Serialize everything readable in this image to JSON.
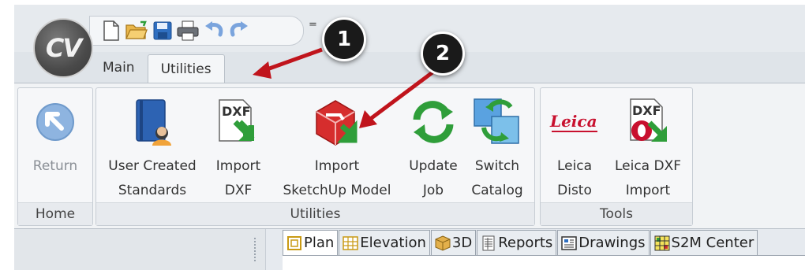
{
  "app": {
    "logo_text": "CV"
  },
  "quick_access": {
    "icons": [
      "new-document-icon",
      "open-folder-icon",
      "save-icon",
      "print-icon",
      "undo-icon",
      "redo-icon"
    ],
    "more_label": "="
  },
  "tabs": [
    {
      "label": "Main"
    },
    {
      "label": "Utilities"
    }
  ],
  "ribbon": {
    "home_group": {
      "label": "Home",
      "buttons": [
        {
          "line1": "Return",
          "line2": ""
        }
      ]
    },
    "utilities_group": {
      "label": "Utilities",
      "buttons": [
        {
          "line1": "User Created",
          "line2": "Standards"
        },
        {
          "line1": "Import",
          "line2": "DXF"
        },
        {
          "line1": "Import",
          "line2": "SketchUp Model"
        },
        {
          "line1": "Update",
          "line2": "Job"
        },
        {
          "line1": "Switch",
          "line2": "Catalog"
        }
      ]
    },
    "tools_group": {
      "label": "Tools",
      "buttons": [
        {
          "line1": "Leica",
          "line2": "Disto"
        },
        {
          "line1": "Leica DXF",
          "line2": "Import"
        }
      ]
    },
    "icon_text": {
      "dxf": "DXF",
      "leica": "Leica"
    }
  },
  "doc_tabs": [
    {
      "label": "Plan"
    },
    {
      "label": "Elevation"
    },
    {
      "label": "3D"
    },
    {
      "label": "Reports"
    },
    {
      "label": "Drawings"
    },
    {
      "label": "S2M Center"
    }
  ],
  "callouts": [
    "1",
    "2"
  ],
  "colors": {
    "callout_arrow": "#c0141c",
    "accent_green": "#2f9e3a",
    "accent_blue": "#2f7fc8",
    "sketchup_red": "#d62d2d"
  }
}
